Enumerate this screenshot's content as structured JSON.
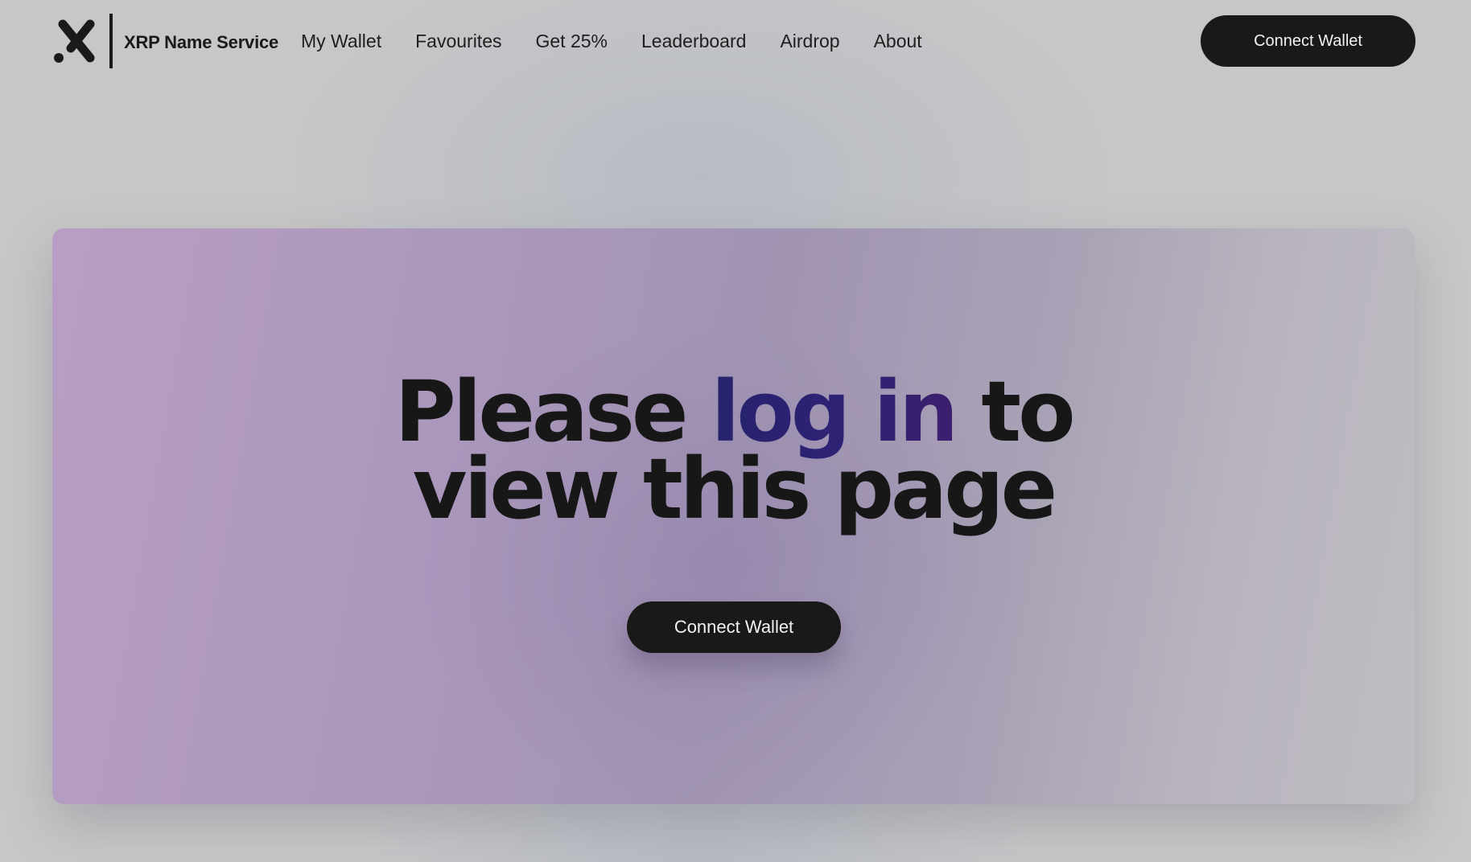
{
  "header": {
    "brand": "XRP Name Service",
    "nav": [
      {
        "label": "My Wallet"
      },
      {
        "label": "Favourites"
      },
      {
        "label": "Get 25%"
      },
      {
        "label": "Leaderboard"
      },
      {
        "label": "Airdrop"
      },
      {
        "label": "About"
      }
    ],
    "connect_label": "Connect Wallet"
  },
  "hero": {
    "heading_part1": "Please ",
    "heading_accent": "log in",
    "heading_part2": " to",
    "heading_line2": "view this page",
    "connect_label": "Connect Wallet"
  },
  "colors": {
    "page_background": "#c7c7c8",
    "button_background": "#191919",
    "button_text": "#f2f2f2",
    "accent_start": "#26236b",
    "accent_end": "#3c1f6e",
    "hero_gradient_left": "#b89ec4",
    "hero_gradient_right": "#bfbcc2"
  },
  "icons": {
    "logo": "x-logo-icon"
  }
}
